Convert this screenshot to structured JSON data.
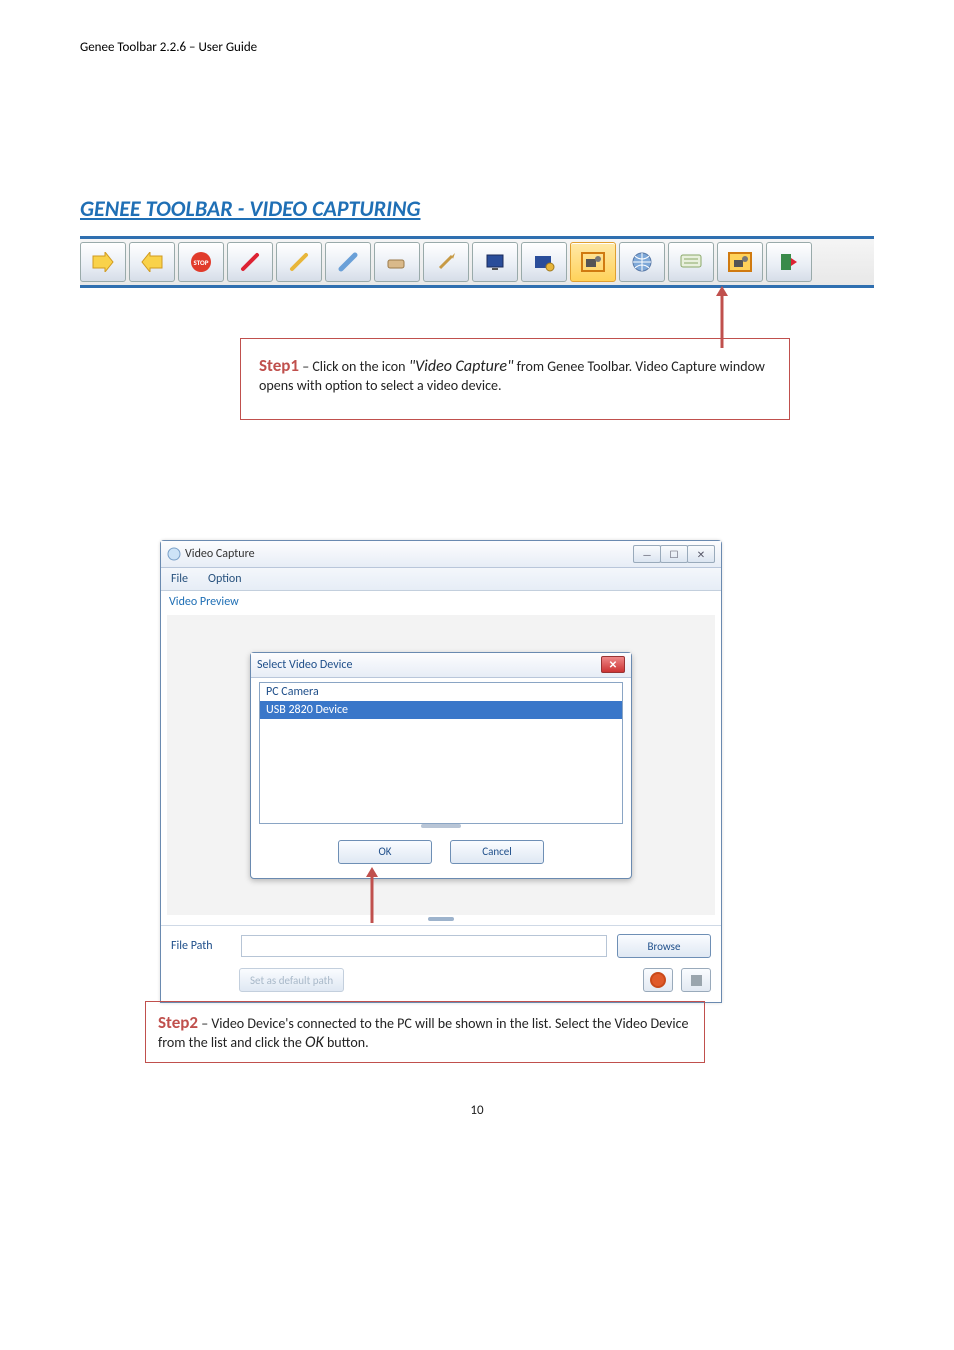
{
  "doc_header": "Genee Toolbar 2.2.6 – User Guide",
  "section_title": "GENEE TOOLBAR - VIDEO CAPTURING",
  "toolbar": {
    "items": [
      {
        "id": "next-arrow-icon"
      },
      {
        "id": "back-arrow-icon"
      },
      {
        "id": "stop-icon"
      },
      {
        "id": "pen-red-icon"
      },
      {
        "id": "pen-yellow-icon"
      },
      {
        "id": "highlighter-icon"
      },
      {
        "id": "eraser-icon"
      },
      {
        "id": "pointer-icon"
      },
      {
        "id": "screen-icon"
      },
      {
        "id": "snapshot-icon"
      },
      {
        "id": "video-capture-icon",
        "selected": true
      },
      {
        "id": "globe-icon"
      },
      {
        "id": "keyboard-icon"
      },
      {
        "id": "camera-highlight-icon"
      },
      {
        "id": "exit-icon"
      }
    ]
  },
  "callout1": {
    "step": "Step1",
    "text_before": " – Click on the icon ",
    "emph": "\"Video Capture\"",
    "text_after": " from Genee Toolbar. Video Capture window opens with option to select a video device."
  },
  "window": {
    "title": "Video Capture",
    "menu": {
      "file": "File",
      "option": "Option"
    },
    "preview_label": "Video Preview",
    "dialog": {
      "title": "Select Video Device",
      "items": [
        "PC Camera",
        "USB 2820 Device"
      ],
      "selected_index": 1,
      "ok": "OK",
      "cancel": "Cancel"
    },
    "file_path_label": "File Path",
    "browse_label": "Browse",
    "set_default_label": "Set as default path"
  },
  "callout2": {
    "step": "Step2",
    "text_a": " – Video Device's connected to the PC will be shown in the list. Select the Video Device from the list and click the ",
    "emph": "OK",
    "text_b": " button."
  },
  "page_number": "10"
}
